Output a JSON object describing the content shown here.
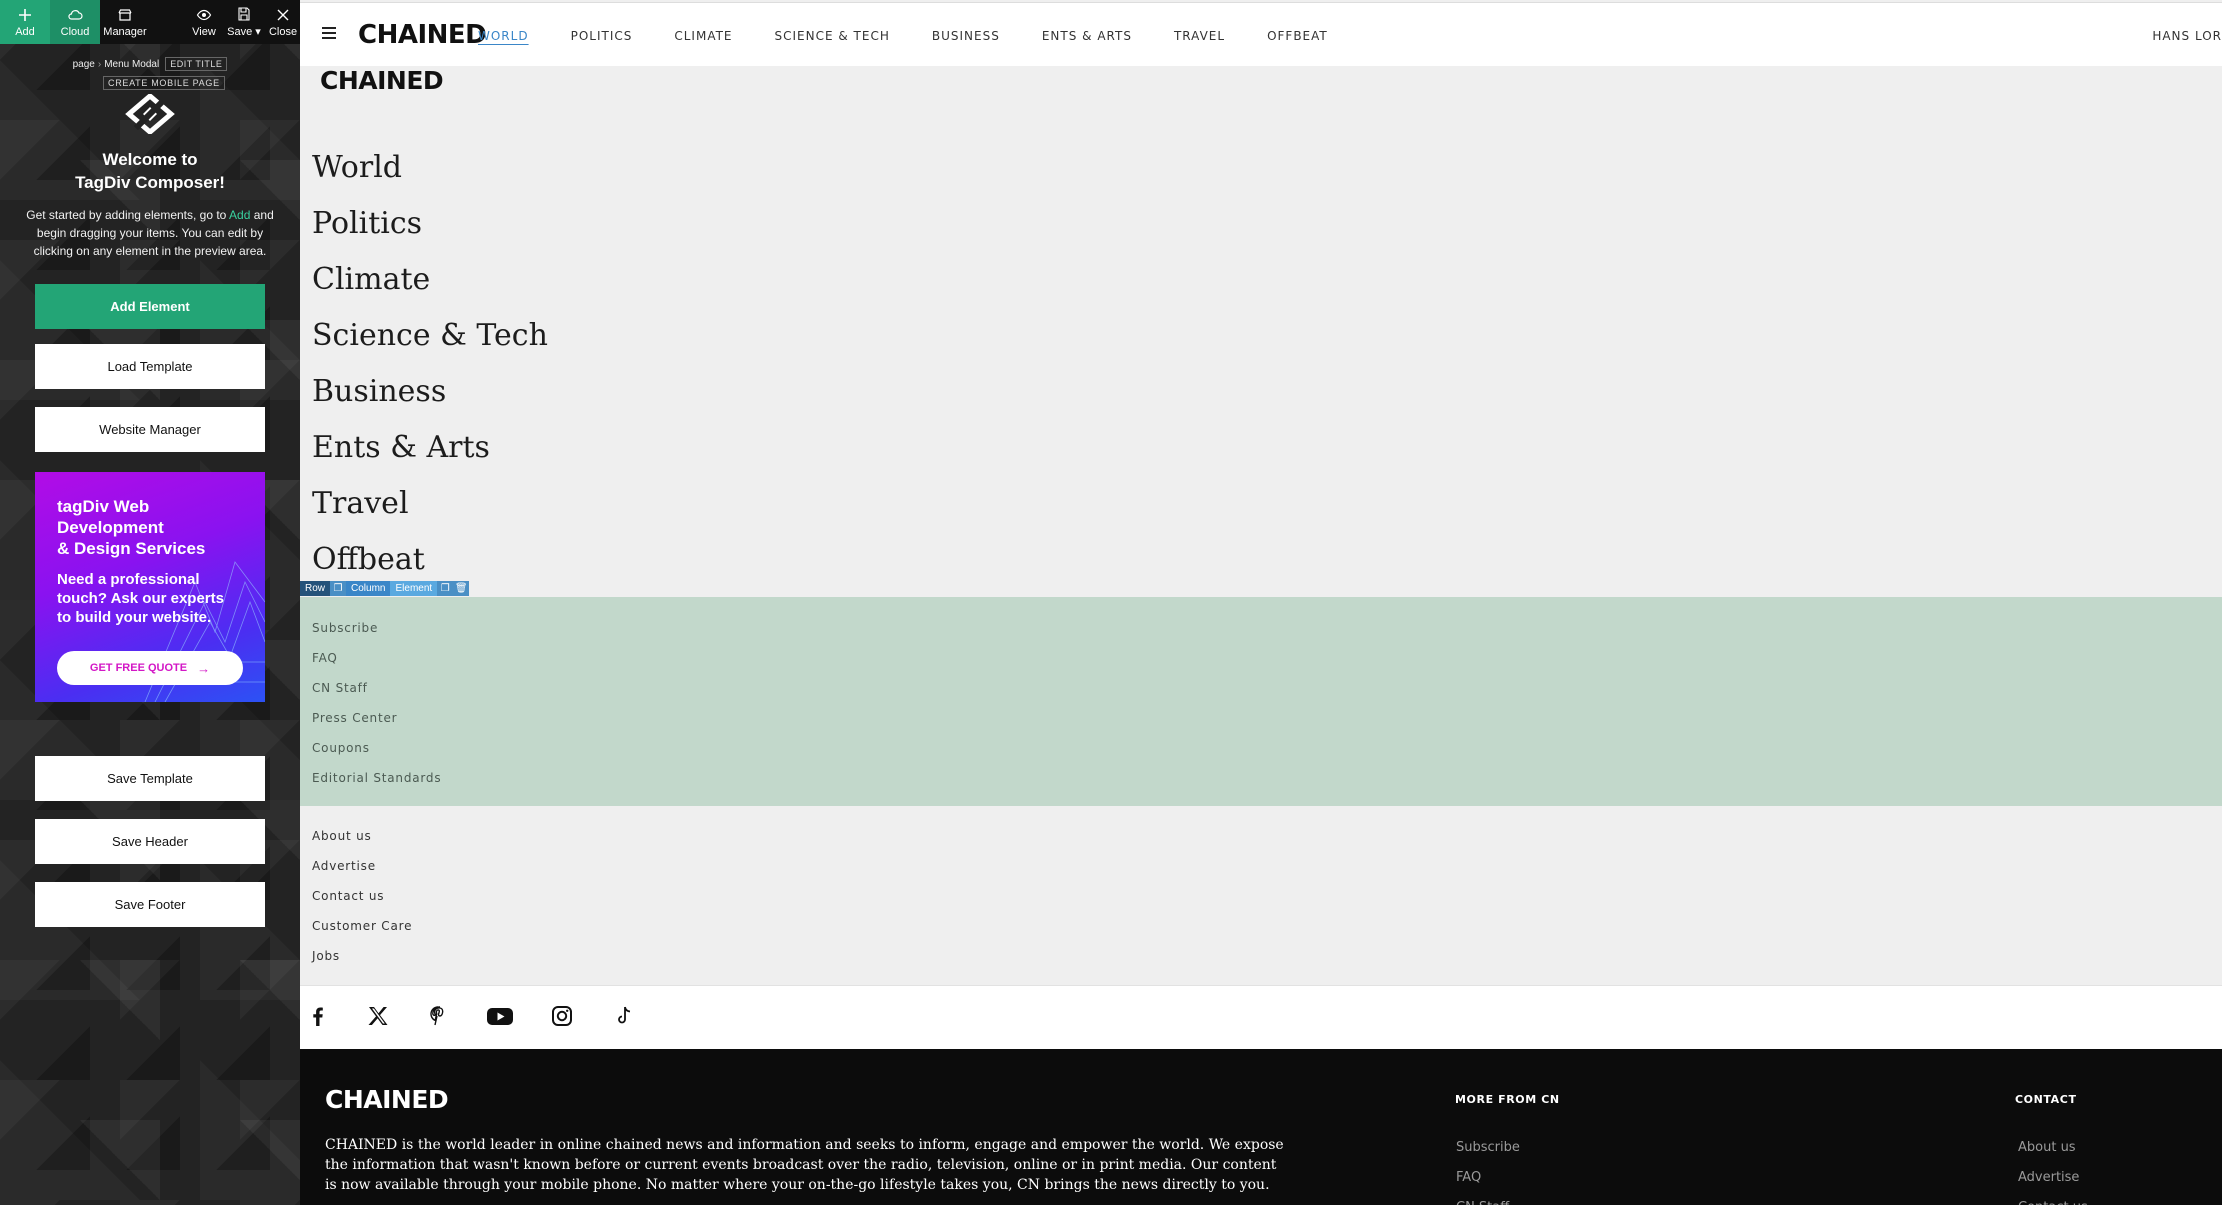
{
  "toolbar": {
    "add": "Add",
    "cloud": "Cloud",
    "manager": "Manager",
    "view": "View",
    "save": "Save ▾",
    "close": "Close"
  },
  "crumbs": {
    "page": "page",
    "current": "Menu Modal",
    "edit_title": "EDIT TITLE",
    "create_mobile": "CREATE MOBILE PAGE"
  },
  "welcome": {
    "title": "Welcome to\nTagDiv Composer!",
    "intro_pre": "Get started by adding elements, go to ",
    "intro_highlight": "Add",
    "intro_post": " and begin dragging your items. You can edit by clicking on any element in the preview area."
  },
  "buttons": {
    "add_element": "Add Element",
    "load_template": "Load Template",
    "website_manager": "Website Manager",
    "save_template": "Save Template",
    "save_header": "Save Header",
    "save_footer": "Save Footer"
  },
  "promo": {
    "title": "tagDiv Web\nDevelopment\n& Design Services",
    "subtitle": "Need a professional\ntouch? Ask our experts\nto build your website.",
    "cta": "GET FREE QUOTE",
    "cta_arrow": "→"
  },
  "site": {
    "brand": "CHAINED",
    "user": "HANS LOR",
    "nav": [
      "WORLD",
      "POLITICS",
      "CLIMATE",
      "SCIENCE & TECH",
      "BUSINESS",
      "ENTS & ARTS",
      "TRAVEL",
      "OFFBEAT"
    ],
    "menu_items": [
      "World",
      "Politics",
      "Climate",
      "Science & Tech",
      "Business",
      "Ents & Arts",
      "Travel",
      "Offbeat"
    ],
    "element_tools": {
      "row": "Row",
      "column": "Column",
      "element": "Element"
    },
    "links_a": [
      "Subscribe",
      "FAQ",
      "CN Staff",
      "Press Center",
      "Coupons",
      "Editorial Standards"
    ],
    "links_b": [
      "About us",
      "Advertise",
      "Contact us",
      "Customer Care",
      "Jobs"
    ],
    "social_icons": [
      "facebook-icon",
      "x-twitter-icon",
      "pinterest-icon",
      "youtube-icon",
      "instagram-icon",
      "tiktok-icon"
    ]
  },
  "footer": {
    "brand": "CHAINED",
    "description": "CHAINED is the world leader in online chained news and information and seeks to inform, engage and empower the world. We expose the information that wasn't known before or current events broadcast over the radio, television, online or in print media. Our content is now available through your mobile phone. No matter where your on-the-go lifestyle takes you, CN brings the news directly to you.",
    "more_title": "MORE FROM CN",
    "more_links": [
      "Subscribe",
      "FAQ",
      "CN Staff"
    ],
    "contact_title": "CONTACT",
    "contact_links": [
      "About us",
      "Advertise",
      "Contact us"
    ]
  },
  "colors": {
    "accent_green": "#23a576",
    "nav_active": "#3a86c8",
    "green_block": "#c2d8cb",
    "footer_bg": "#0c0c0c"
  }
}
